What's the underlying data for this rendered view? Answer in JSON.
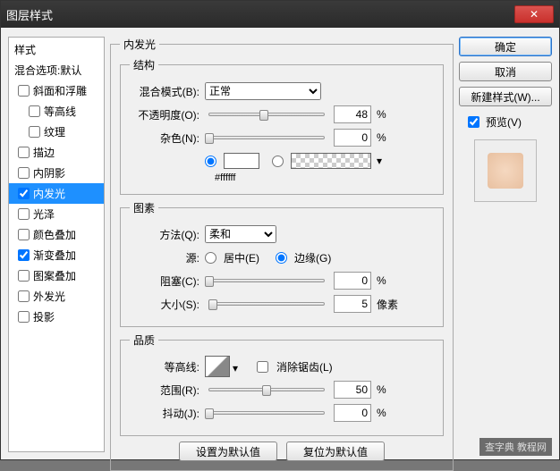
{
  "window": {
    "title": "图层样式"
  },
  "sidebar": {
    "head1": "样式",
    "head2": "混合选项:默认",
    "items": [
      {
        "label": "斜面和浮雕",
        "checked": false
      },
      {
        "label": "等高线",
        "checked": false,
        "indent": true
      },
      {
        "label": "纹理",
        "checked": false,
        "indent": true
      },
      {
        "label": "描边",
        "checked": false
      },
      {
        "label": "内阴影",
        "checked": false
      },
      {
        "label": "内发光",
        "checked": true,
        "active": true
      },
      {
        "label": "光泽",
        "checked": false
      },
      {
        "label": "颜色叠加",
        "checked": false
      },
      {
        "label": "渐变叠加",
        "checked": true
      },
      {
        "label": "图案叠加",
        "checked": false
      },
      {
        "label": "外发光",
        "checked": false
      },
      {
        "label": "投影",
        "checked": false
      }
    ]
  },
  "panel": {
    "title": "内发光",
    "structure": {
      "legend": "结构",
      "blend_label": "混合模式(B):",
      "blend_value": "正常",
      "opacity_label": "不透明度(O):",
      "opacity_value": "48",
      "opacity_unit": "%",
      "noise_label": "杂色(N):",
      "noise_value": "0",
      "noise_unit": "%",
      "hex": "#ffffff"
    },
    "elements": {
      "legend": "图素",
      "technique_label": "方法(Q):",
      "technique_value": "柔和",
      "source_label": "源:",
      "source_center": "居中(E)",
      "source_edge": "边缘(G)",
      "choke_label": "阻塞(C):",
      "choke_value": "0",
      "choke_unit": "%",
      "size_label": "大小(S):",
      "size_value": "5",
      "size_unit": "像素"
    },
    "quality": {
      "legend": "品质",
      "contour_label": "等高线:",
      "antialias": "消除锯齿(L)",
      "range_label": "范围(R):",
      "range_value": "50",
      "range_unit": "%",
      "jitter_label": "抖动(J):",
      "jitter_value": "0",
      "jitter_unit": "%"
    },
    "defaults": {
      "set": "设置为默认值",
      "reset": "复位为默认值"
    }
  },
  "right": {
    "ok": "确定",
    "cancel": "取消",
    "newstyle": "新建样式(W)...",
    "preview": "预览(V)"
  },
  "watermark": "查字典 教程网"
}
